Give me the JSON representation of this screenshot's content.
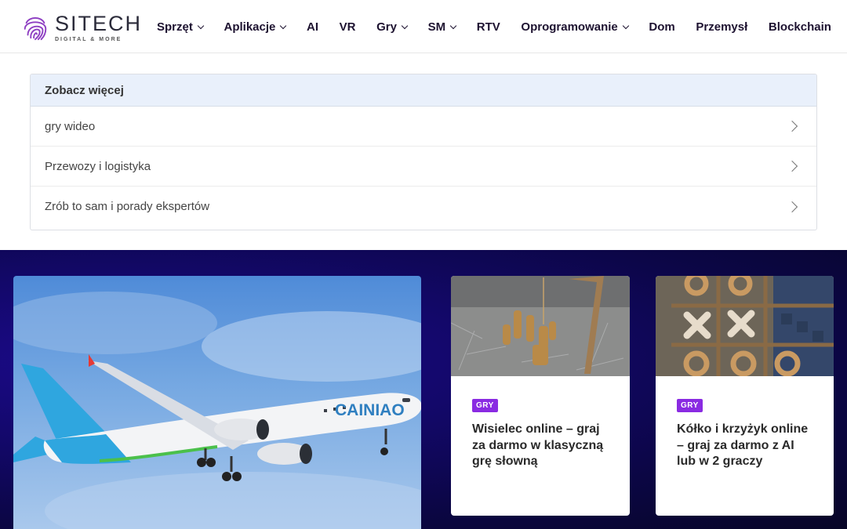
{
  "brand": {
    "name": "SITECH",
    "tagline": "DIGITAL & MORE"
  },
  "nav": [
    {
      "label": "Sprzęt",
      "dropdown": true
    },
    {
      "label": "Aplikacje",
      "dropdown": true
    },
    {
      "label": "AI",
      "dropdown": false
    },
    {
      "label": "VR",
      "dropdown": false
    },
    {
      "label": "Gry",
      "dropdown": true
    },
    {
      "label": "SM",
      "dropdown": true
    },
    {
      "label": "RTV",
      "dropdown": false
    },
    {
      "label": "Oprogramowanie",
      "dropdown": true
    },
    {
      "label": "Dom",
      "dropdown": false
    },
    {
      "label": "Przemysł",
      "dropdown": false
    },
    {
      "label": "Blockchain",
      "dropdown": false
    }
  ],
  "see_more": {
    "title": "Zobacz więcej",
    "items": [
      {
        "label": "gry wideo"
      },
      {
        "label": "Przewozy i logistyka"
      },
      {
        "label": "Zrób to sam i porady ekspertów"
      }
    ]
  },
  "hero": {
    "image": "cargo-airplane-photo",
    "livery_text": "CAINIAO"
  },
  "cards": [
    {
      "category": "GRY",
      "title": "Wisielec online – graj za darmo w klasyczną grę słowną",
      "image": "hangman-chess-pieces-photo"
    },
    {
      "category": "GRY",
      "title": "Kółko i krzyżyk online – graj za darmo z AI lub w 2 graczy",
      "image": "tic-tac-toe-board-photo"
    }
  ],
  "colors": {
    "nav_text": "#1d1230",
    "badge": "#8a2be2",
    "dark_bg": "#0b0644",
    "see_more_header": "#e9f0fb"
  }
}
